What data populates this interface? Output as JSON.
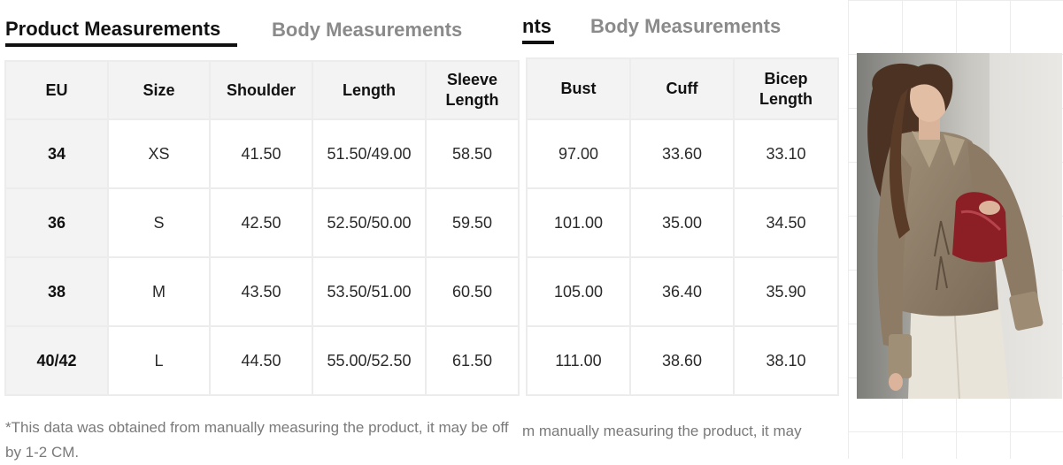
{
  "tabs_left": {
    "active": "Product Measurements",
    "inactive": "Body Measurements"
  },
  "tabs_right": {
    "active_fragment": "nts",
    "inactive": "Body Measurements"
  },
  "left_table": {
    "headers": [
      "EU",
      "Size",
      "Shoulder",
      "Length",
      "Sleeve Length"
    ],
    "rows": [
      [
        "34",
        "XS",
        "41.50",
        "51.50/49.00",
        "58.50"
      ],
      [
        "36",
        "S",
        "42.50",
        "52.50/50.00",
        "59.50"
      ],
      [
        "38",
        "M",
        "43.50",
        "53.50/51.00",
        "60.50"
      ],
      [
        "40/42",
        "L",
        "44.50",
        "55.00/52.50",
        "61.50"
      ]
    ]
  },
  "right_table": {
    "headers": [
      "Bust",
      "Cuff",
      "Bicep Length"
    ],
    "rows": [
      [
        "97.00",
        "33.60",
        "33.10"
      ],
      [
        "101.00",
        "35.00",
        "34.50"
      ],
      [
        "105.00",
        "36.40",
        "35.90"
      ],
      [
        "111.00",
        "38.60",
        "38.10"
      ]
    ]
  },
  "note_left": "*This data was obtained from manually measuring the product, it may be off by 1-2 CM.",
  "note_right": "m manually measuring the product, it may",
  "colors": {
    "header_bg": "#f3f3f3",
    "border": "#ececec",
    "accent": "#111111",
    "muted": "#8a8a8a"
  }
}
